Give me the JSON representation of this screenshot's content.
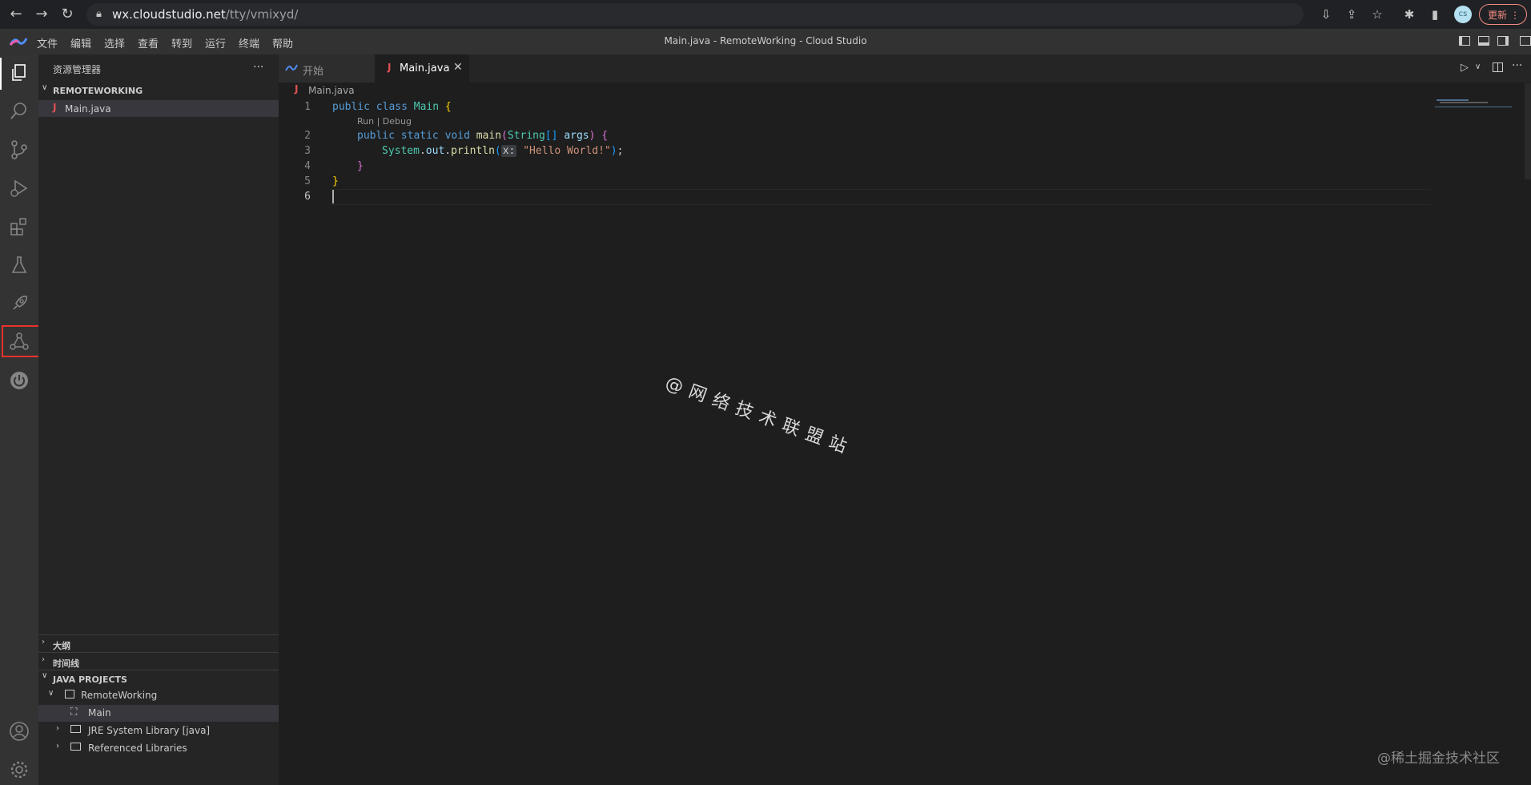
{
  "browser": {
    "url_host": "wx.cloudstudio.net",
    "url_path": "/tty/vmixyd/",
    "update_label": "更新",
    "avatar_text": "cs"
  },
  "menu": [
    "文件",
    "编辑",
    "选择",
    "查看",
    "转到",
    "运行",
    "终端",
    "帮助"
  ],
  "window_title": "Main.java - RemoteWorking - Cloud Studio",
  "sidebar": {
    "explorer_title": "资源管理器",
    "more_label": "···",
    "workspace": "REMOTEWORKING",
    "files": [
      "Main.java"
    ],
    "outline": "大纲",
    "timeline": "时间线",
    "java_projects": "JAVA PROJECTS",
    "project": "RemoteWorking",
    "project_children": [
      "Main",
      "JRE System Library [java]",
      "Referenced Libraries"
    ]
  },
  "tabs": [
    {
      "label": "开始"
    },
    {
      "label": "Main.java"
    }
  ],
  "breadcrumb": "Main.java",
  "codelens": "Run | Debug",
  "code": {
    "line1": {
      "num": "1",
      "kw1": "public",
      "kw2": "class",
      "cls": "Main",
      "brace": "{"
    },
    "line2": {
      "num": "2",
      "kw1": "public",
      "kw2": "static",
      "kw3": "void",
      "fn": "main",
      "p1": "(",
      "type": "String",
      "arr": "[]",
      "arg": "args",
      "p2": ")",
      "brace": "{"
    },
    "line3": {
      "num": "3",
      "obj": "System",
      "dot1": ".",
      "field": "out",
      "dot2": ".",
      "fn": "println",
      "p1": "(",
      "hint": "x:",
      "str": "\"Hello World!\"",
      "p2": ")",
      "semi": ";"
    },
    "line4": {
      "num": "4",
      "brace": "}"
    },
    "line5": {
      "num": "5",
      "brace": "}"
    },
    "line6": {
      "num": "6"
    }
  },
  "watermark": "@网络技术联盟站",
  "corner_watermark": "@稀土掘金技术社区",
  "colors": {
    "highlight": "#e8332a",
    "accent": "#0078d4"
  }
}
